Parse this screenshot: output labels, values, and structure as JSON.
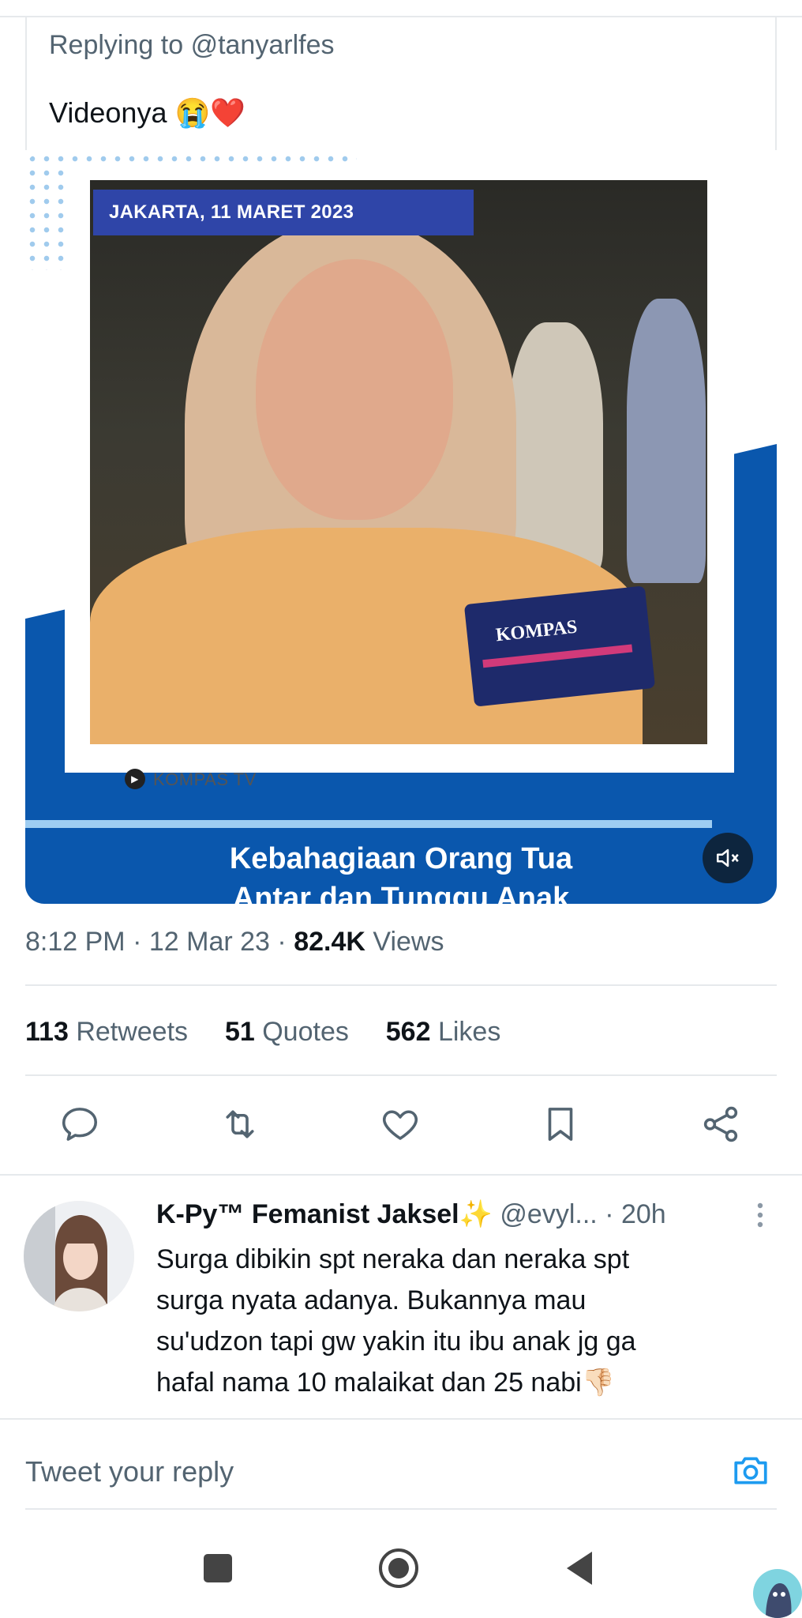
{
  "tweet": {
    "replying_to_prefix": "Replying to",
    "replying_to_handle": "@tanyarlfes",
    "text": "Videonya 😭❤️",
    "video": {
      "date_banner": "JAKARTA, 11 MARET 2023",
      "mic_label": "KOMPAS",
      "credit": "KOMPAS TV",
      "headline_line1": "Kebahagiaan Orang Tua",
      "headline_line2": "Antar dan Tunggu Anak"
    },
    "time": "8:12 PM",
    "date": "12 Mar 23",
    "views_count": "82.4K",
    "views_label": "Views",
    "retweets_count": "113",
    "retweets_label": "Retweets",
    "quotes_count": "51",
    "quotes_label": "Quotes",
    "likes_count": "562",
    "likes_label": "Likes"
  },
  "reply": {
    "name": "K-Py™ Femanist Jaksel✨",
    "handle": "@evyl...",
    "time": "20h",
    "lines": [
      "Surga dibikin spt neraka dan neraka spt",
      "surga nyata adanya. Bukannya mau",
      "su'udzon tapi gw yakin itu ibu anak jg ga",
      "hafal nama 10 malaikat dan 25 nabi👎🏻"
    ]
  },
  "compose": {
    "placeholder": "Tweet your reply"
  },
  "colors": {
    "accent": "#1d9bf0",
    "text_secondary": "#536471",
    "video_blue": "#0a57ad"
  },
  "icons": [
    "reply-icon",
    "retweet-icon",
    "like-icon",
    "bookmark-icon",
    "share-icon",
    "more-icon",
    "camera-icon",
    "mute-icon",
    "nav-square-icon",
    "nav-home-icon",
    "nav-back-icon"
  ]
}
